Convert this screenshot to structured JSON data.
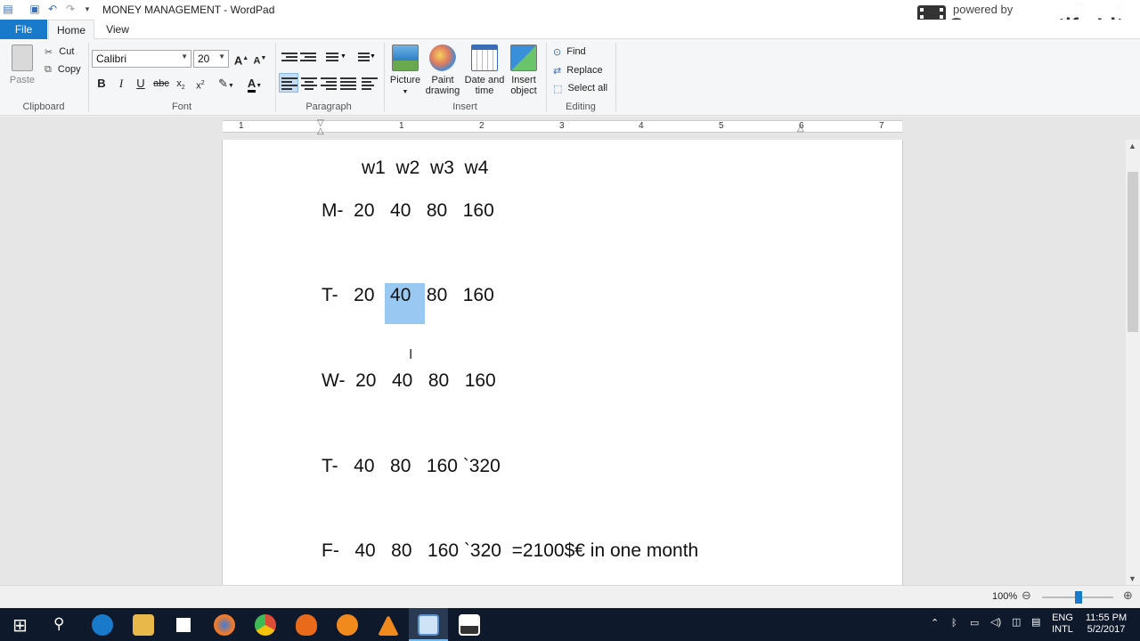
{
  "window": {
    "title": "MONEY MANAGEMENT - WordPad"
  },
  "watermark": {
    "powered_by": "powered by",
    "brand": "Screencastify Lite"
  },
  "tabs": {
    "file": "File",
    "home": "Home",
    "view": "View"
  },
  "clipboard": {
    "paste": "Paste",
    "cut": "Cut",
    "copy": "Copy",
    "group": "Clipboard"
  },
  "font": {
    "family": "Calibri",
    "size": "20",
    "group": "Font"
  },
  "paragraph": {
    "group": "Paragraph"
  },
  "insert": {
    "picture": "Picture",
    "paint1": "Paint",
    "paint2": "drawing",
    "date1": "Date and",
    "date2": "time",
    "obj1": "Insert",
    "obj2": "object",
    "group": "Insert"
  },
  "editing": {
    "find": "Find",
    "replace": "Replace",
    "select_all": "Select all",
    "group": "Editing"
  },
  "ruler": {
    "numbers": [
      "1",
      "1",
      "2",
      "3",
      "4",
      "5",
      "6",
      "7"
    ]
  },
  "document": {
    "header": "w1  w2  w3  w4",
    "rows": [
      "M-  20   40   80   160",
      "T-   20   40   80   160",
      "W-  20   40   80   160",
      "T-   40   80   160 `320",
      "F-   40   80   160 `320  =2100$€ in one month"
    ]
  },
  "status": {
    "zoom": "100%"
  },
  "taskbar": {
    "lang1": "ENG",
    "lang2": "INTL",
    "time": "11:55 PM",
    "date": "5/2/2017"
  },
  "colors": {
    "file_tab": "#1979ca",
    "selection": "#99c9f2",
    "taskbar": "#0e1a2b"
  }
}
